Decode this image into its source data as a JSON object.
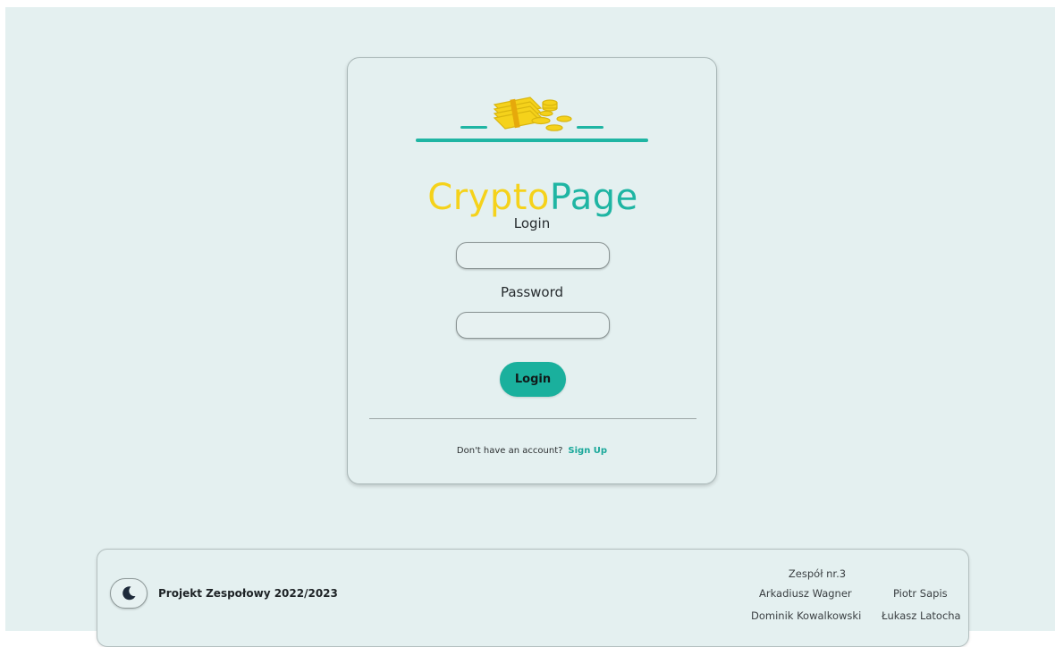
{
  "logo": {
    "text_part1": "Crypto",
    "text_part2": "Page",
    "icon": "money-stack-coins-icon",
    "colors": {
      "yellow": "#f5d21b",
      "teal": "#1fb5a3"
    }
  },
  "form": {
    "login_label": "Login",
    "login_value": "",
    "password_label": "Password",
    "password_value": "",
    "submit_label": "Login"
  },
  "signup": {
    "prompt": "Don't have an account?",
    "link_label": "Sign Up"
  },
  "footer": {
    "theme_icon": "moon-icon",
    "project_title": "Projekt Zespołowy 2022/2023",
    "team_title": "Zespół nr.3",
    "members": [
      "Arkadiusz Wagner",
      "Piotr Sapis",
      "Dominik Kowalkowski",
      "Łukasz Latocha"
    ]
  },
  "colors": {
    "background": "#e4f0f0",
    "accent": "#1ab09d",
    "link": "#1aa89a"
  }
}
